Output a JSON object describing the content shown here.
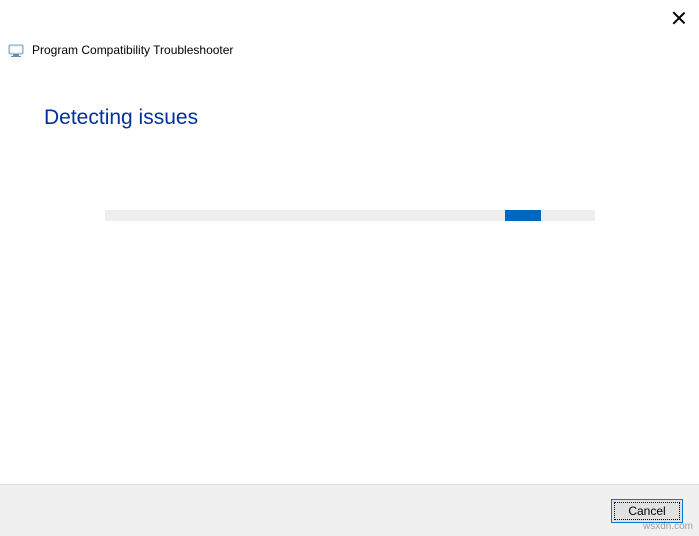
{
  "window": {
    "title": "Program Compatibility Troubleshooter"
  },
  "heading": "Detecting issues",
  "buttons": {
    "cancel": "Cancel"
  },
  "colors": {
    "heading": "#003399",
    "progress_track": "#eeeeee",
    "progress_chunk": "#0067c0",
    "footer_bg": "#f0f0f0"
  },
  "watermark": "wsxdn.com"
}
